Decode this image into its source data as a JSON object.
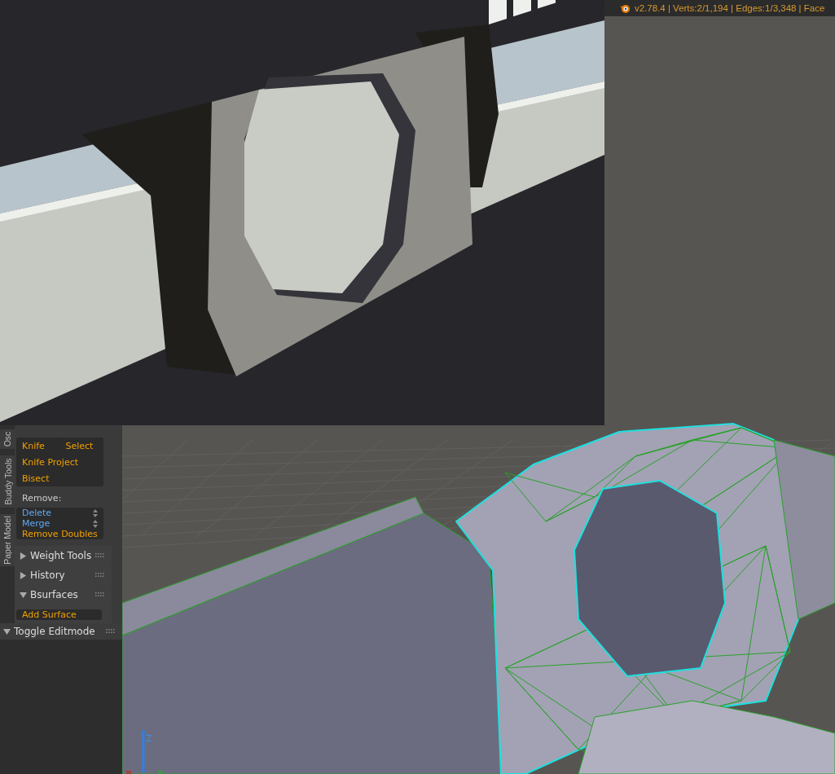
{
  "header": {
    "stats": "v2.78.4 | Verts:2/1,194 | Edges:1/3,348 | Face"
  },
  "tool_shelf": {
    "tabs": [
      {
        "label": "Osc",
        "selected": false
      },
      {
        "label": "Buddy Tools",
        "selected": false
      },
      {
        "label": "Paper Model",
        "selected": false
      }
    ],
    "edit_rows": [
      [
        "Knife",
        "Select"
      ],
      [
        "Knife Project"
      ],
      [
        "Bisect"
      ]
    ],
    "remove_label": "Remove:",
    "remove_buttons": [
      {
        "label": "Delete",
        "kind": "menu"
      },
      {
        "label": "Merge",
        "kind": "menu"
      },
      {
        "label": "Remove Doubles",
        "kind": "operator"
      }
    ],
    "panels": [
      {
        "title": "Weight Tools",
        "expanded": false
      },
      {
        "title": "History",
        "expanded": false
      },
      {
        "title": "Bsurfaces",
        "expanded": true,
        "buttons": [
          "Add Surface"
        ]
      }
    ]
  },
  "operator_panel": {
    "title": "Toggle Editmode",
    "expanded": true
  },
  "viewport": {
    "axis_label": "Z"
  }
}
